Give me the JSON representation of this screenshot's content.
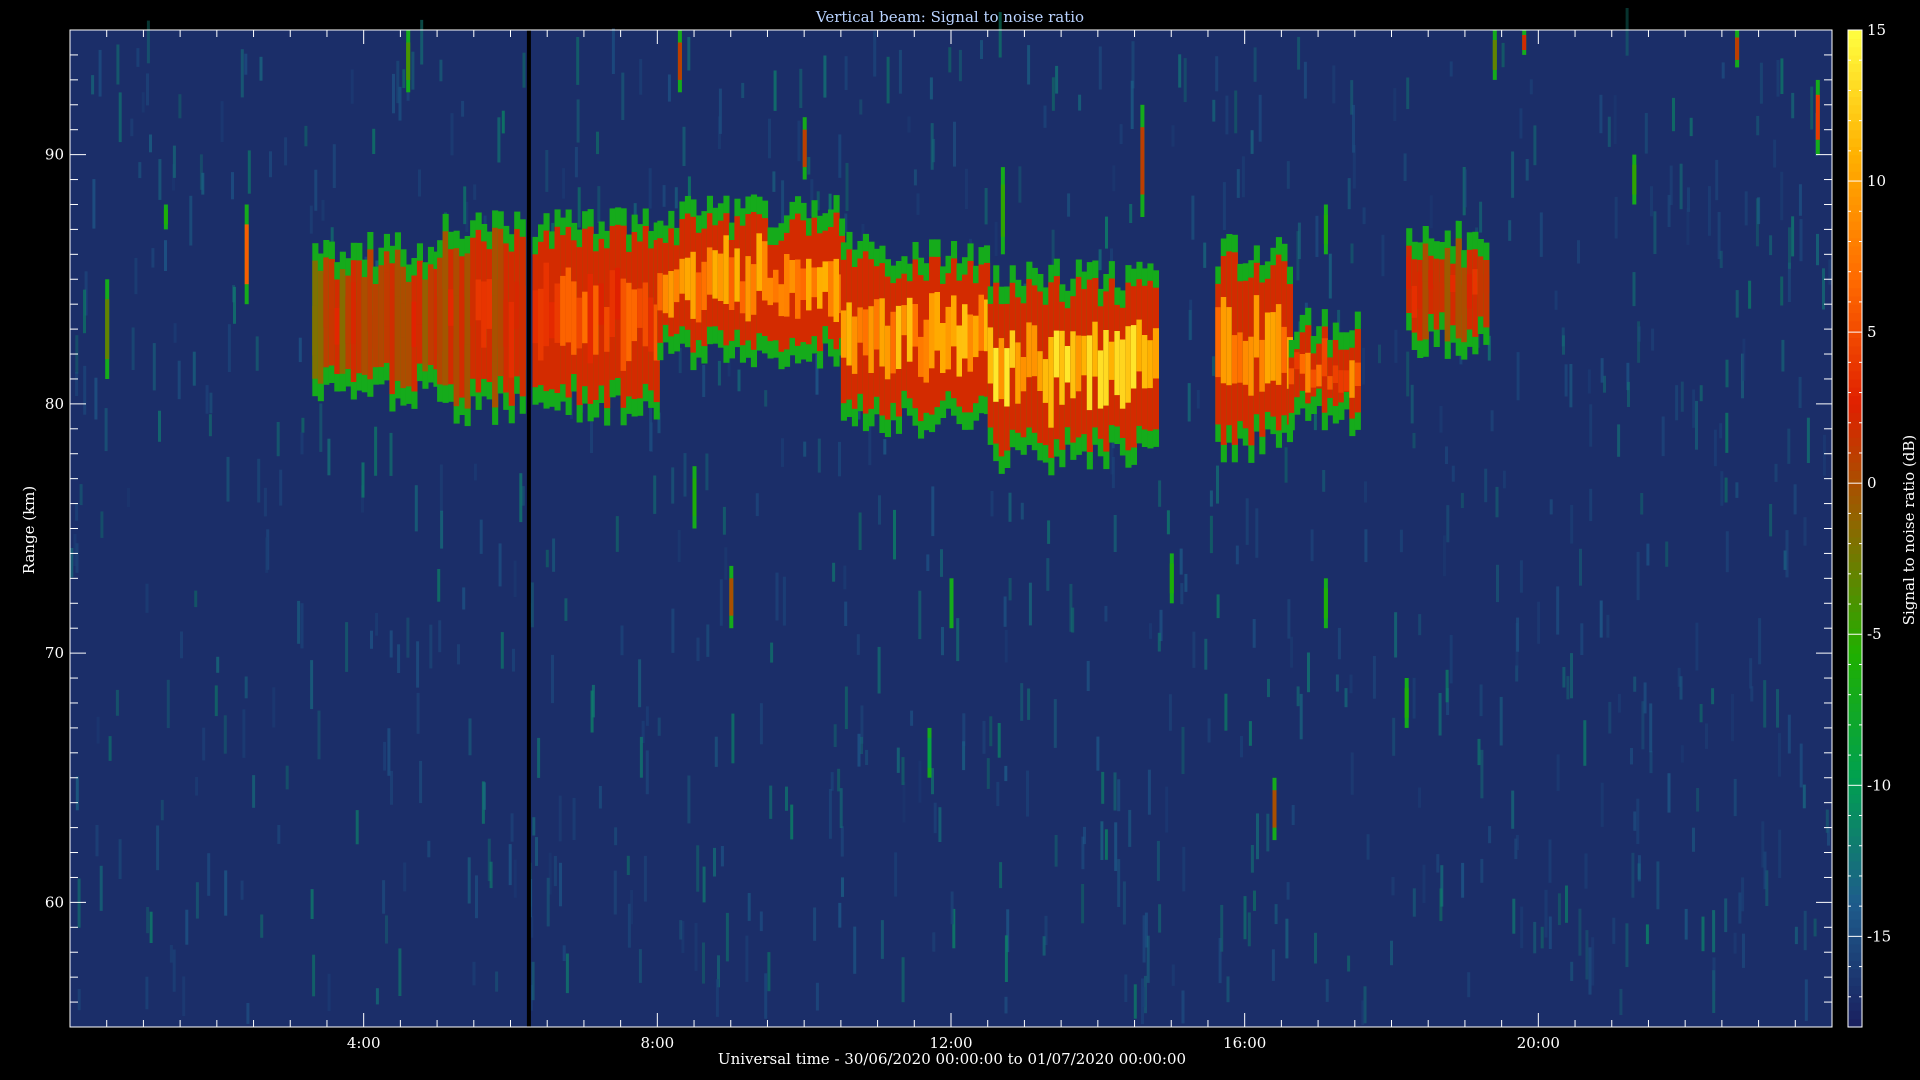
{
  "chart_data": {
    "type": "heatmap",
    "title": "Vertical beam: Signal to noise ratio",
    "xlabel": "Universal time - 30/06/2020 00:00:00 to 01/07/2020 00:00:00",
    "ylabel": "Range (km)",
    "xlim": [
      0,
      24
    ],
    "ylim": [
      55,
      95
    ],
    "x_ticks": [
      {
        "value": 4,
        "label": "4:00"
      },
      {
        "value": 8,
        "label": "8:00"
      },
      {
        "value": 12,
        "label": "12:00"
      },
      {
        "value": 16,
        "label": "16:00"
      },
      {
        "value": 20,
        "label": "20:00"
      }
    ],
    "y_ticks": [
      {
        "value": 60,
        "label": "60"
      },
      {
        "value": 70,
        "label": "70"
      },
      {
        "value": 80,
        "label": "80"
      },
      {
        "value": 90,
        "label": "90"
      }
    ],
    "colorbar": {
      "label": "Signal to noise ratio (dB)",
      "range": [
        -18,
        15
      ],
      "ticks": [
        {
          "value": 15,
          "label": "15"
        },
        {
          "value": 10,
          "label": "10"
        },
        {
          "value": 5,
          "label": "5"
        },
        {
          "value": 0,
          "label": "0"
        },
        {
          "value": -5,
          "label": "-5"
        },
        {
          "value": -10,
          "label": "-10"
        },
        {
          "value": -15,
          "label": "-15"
        }
      ],
      "colors": [
        "#1a1f5e",
        "#1e5c8c",
        "#00a050",
        "#1fb000",
        "#8a6a00",
        "#e02000",
        "#ff6a00",
        "#ffb000",
        "#ffff40"
      ]
    },
    "background_value_db": -17,
    "data_gap_time": 6.25,
    "layers": [
      {
        "t0": 3.3,
        "t1": 5.0,
        "top": 85.5,
        "bottom": 81.0,
        "peak_db": 3
      },
      {
        "t0": 5.0,
        "t1": 6.2,
        "top": 86.5,
        "bottom": 80.5,
        "peak_db": 4
      },
      {
        "t0": 6.3,
        "t1": 8.0,
        "top": 86.5,
        "bottom": 80.5,
        "peak_db": 7
      },
      {
        "t0": 8.0,
        "t1": 10.5,
        "top": 87.0,
        "bottom": 82.5,
        "peak_db": 11
      },
      {
        "t0": 10.5,
        "t1": 12.5,
        "top": 85.5,
        "bottom": 80.0,
        "peak_db": 12
      },
      {
        "t0": 12.5,
        "t1": 14.8,
        "top": 84.5,
        "bottom": 78.5,
        "peak_db": 14
      },
      {
        "t0": 15.6,
        "t1": 16.6,
        "top": 85.5,
        "bottom": 79.0,
        "peak_db": 11
      },
      {
        "t0": 16.6,
        "t1": 17.5,
        "top": 82.5,
        "bottom": 80.0,
        "peak_db": 9
      },
      {
        "t0": 18.2,
        "t1": 19.3,
        "top": 86.0,
        "bottom": 83.0,
        "peak_db": 4
      }
    ],
    "spikes": [
      {
        "t": 0.5,
        "r0": 81,
        "r1": 85,
        "peak_db": -3
      },
      {
        "t": 1.3,
        "r0": 87,
        "r1": 88,
        "peak_db": -6
      },
      {
        "t": 2.4,
        "r0": 84,
        "r1": 88,
        "peak_db": 6
      },
      {
        "t": 4.6,
        "r0": 92.5,
        "r1": 95,
        "peak_db": -4
      },
      {
        "t": 8.3,
        "r0": 92.5,
        "r1": 95,
        "peak_db": 1
      },
      {
        "t": 9.0,
        "r0": 71,
        "r1": 73.5,
        "peak_db": 0
      },
      {
        "t": 10.0,
        "r0": 89,
        "r1": 91.5,
        "peak_db": 1
      },
      {
        "t": 8.5,
        "r0": 75,
        "r1": 77.5,
        "peak_db": -6
      },
      {
        "t": 12.7,
        "r0": 86,
        "r1": 89.5,
        "peak_db": -5
      },
      {
        "t": 14.6,
        "r0": 87.5,
        "r1": 92,
        "peak_db": 1
      },
      {
        "t": 15.0,
        "r0": 72,
        "r1": 74,
        "peak_db": -6
      },
      {
        "t": 16.4,
        "r0": 62.5,
        "r1": 65,
        "peak_db": 0
      },
      {
        "t": 17.1,
        "r0": 71,
        "r1": 73,
        "peak_db": -6
      },
      {
        "t": 17.1,
        "r0": 86,
        "r1": 88,
        "peak_db": -6
      },
      {
        "t": 18.2,
        "r0": 67,
        "r1": 69,
        "peak_db": -6
      },
      {
        "t": 19.4,
        "r0": 93,
        "r1": 95,
        "peak_db": -3
      },
      {
        "t": 19.8,
        "r0": 94,
        "r1": 95,
        "peak_db": 2
      },
      {
        "t": 21.3,
        "r0": 88,
        "r1": 90,
        "peak_db": -5
      },
      {
        "t": 22.7,
        "r0": 93.5,
        "r1": 95,
        "peak_db": 1
      },
      {
        "t": 23.8,
        "r0": 90,
        "r1": 93,
        "peak_db": 4
      },
      {
        "t": 12.0,
        "r0": 71,
        "r1": 73,
        "peak_db": -7
      },
      {
        "t": 11.7,
        "r0": 65,
        "r1": 67,
        "peak_db": -9
      }
    ]
  }
}
